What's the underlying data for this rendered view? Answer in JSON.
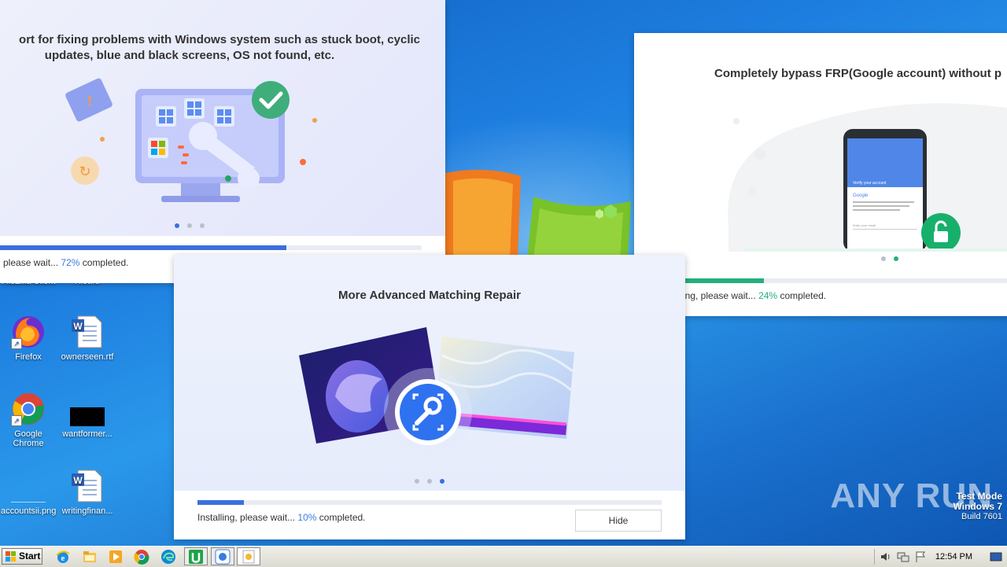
{
  "desktop": {
    "icons": [
      {
        "label": "FileZilla Client",
        "kind": "filezilla"
      },
      {
        "label": "Hiot.rtf",
        "kind": "word"
      },
      {
        "label": "Firefox",
        "kind": "firefox"
      },
      {
        "label": "ownerseen.rtf",
        "kind": "word"
      },
      {
        "label": "Google Chrome",
        "kind": "chrome"
      },
      {
        "label": "wantformer...",
        "kind": "black"
      },
      {
        "label": "accountsii.png",
        "kind": "blank"
      },
      {
        "label": "writingfinan...",
        "kind": "word"
      }
    ],
    "watermark": "ANY RUN",
    "testmode": {
      "line1": "Test Mode",
      "line2": "Windows 7",
      "line3": "Build 7601"
    }
  },
  "window_left": {
    "title": "ort for fixing problems with Windows system such as stuck boot, cyclic updates, blue and black screens, OS not found, etc.",
    "title_line1": "ort for fixing problems with Windows system such as stuck boot, cyclic",
    "title_line2": "updates, blue and black screens, OS not found, etc.",
    "dots_active": 0,
    "progress": 0.72,
    "status_prefix": "please wait...",
    "status_pct": "72%",
    "status_suffix": "completed.",
    "accent": "#3b6fe0"
  },
  "window_right": {
    "title": "Completely bypass FRP(Google account) without p",
    "phone_screen_title": "Verify your account",
    "phone_brand": "Google",
    "phone_body": "This device was reset. To continue, sign in with a Google Account that was previously synced on this device",
    "phone_input": "Enter your email",
    "dots_active": 1,
    "progress": 0.24,
    "status_prefix": "ing, please wait...",
    "status_pct": "24%",
    "status_suffix": "completed.",
    "accent": "#22b07d"
  },
  "window_main": {
    "title": "More Advanced Matching Repair",
    "dots_active": 2,
    "progress": 0.1,
    "status_prefix": "Installing, please wait...",
    "status_pct": "10%",
    "status_suffix": "completed.",
    "hide_label": "Hide",
    "accent": "#3b6fe0"
  },
  "taskbar": {
    "start_label": "Start",
    "clock": "12:54 PM",
    "apps": [
      "ie-icon",
      "explorer-icon",
      "media-player-icon",
      "chrome-icon",
      "edge-icon",
      "green-app-icon",
      "setup-icon",
      "installer-icon"
    ]
  }
}
